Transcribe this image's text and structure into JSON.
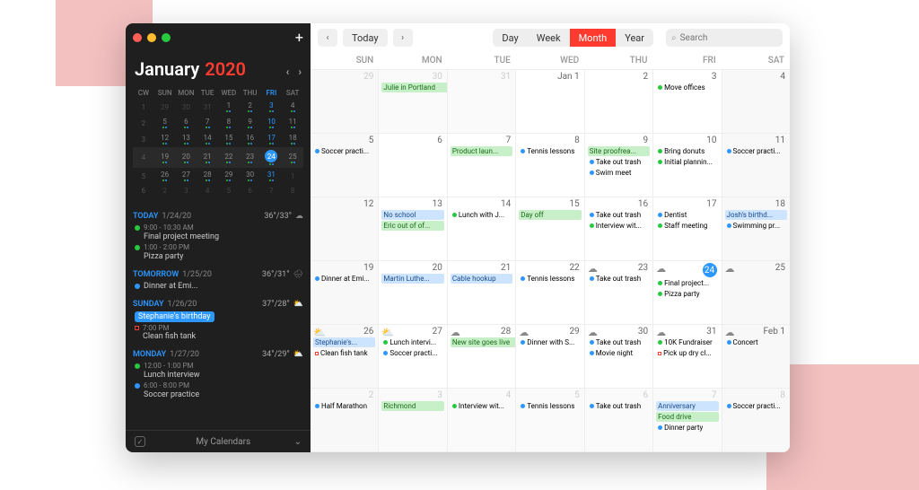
{
  "sidebar": {
    "month": "January",
    "year": "2020",
    "mini_headers": [
      "CW",
      "SUN",
      "MON",
      "TUE",
      "WED",
      "THU",
      "FRI",
      "SAT"
    ],
    "mini_rows": [
      {
        "cw": 1,
        "days": [
          29,
          30,
          31,
          1,
          2,
          3,
          4
        ],
        "dim": [
          0,
          1,
          2
        ]
      },
      {
        "cw": 2,
        "days": [
          5,
          6,
          7,
          8,
          9,
          10,
          11
        ]
      },
      {
        "cw": 3,
        "days": [
          12,
          13,
          14,
          15,
          16,
          17,
          18
        ]
      },
      {
        "cw": 4,
        "days": [
          19,
          20,
          21,
          22,
          23,
          24,
          25
        ],
        "sel": true,
        "today": 5
      },
      {
        "cw": 5,
        "days": [
          26,
          27,
          28,
          29,
          30,
          31,
          1
        ],
        "dim": [
          6
        ]
      },
      {
        "cw": 6,
        "days": [
          2,
          3,
          4,
          5,
          6,
          7,
          8
        ],
        "dim": [
          0,
          1,
          2,
          3,
          4,
          5,
          6
        ]
      }
    ],
    "agenda": [
      {
        "label": "TODAY",
        "date": "1/24/20",
        "temp": "36°/33°",
        "weather": "cloud",
        "events": [
          {
            "dot": "green",
            "time": "9:00 - 10:30 AM",
            "title": "Final project meeting"
          },
          {
            "dot": "green",
            "time": "1:00 - 2:00 PM",
            "title": "Pizza party"
          }
        ]
      },
      {
        "label": "TOMORROW",
        "date": "1/25/20",
        "temp": "36°/31°",
        "weather": "rain",
        "events": [
          {
            "dot": "blue",
            "title": "Dinner at Emi..."
          }
        ]
      },
      {
        "label": "SUNDAY",
        "date": "1/26/20",
        "temp": "37°/28°",
        "weather": "partly",
        "events": [
          {
            "pill": true,
            "title": "Stephanie's birthday"
          },
          {
            "sq": true,
            "time": "7:00 PM",
            "title": "Clean fish tank"
          }
        ]
      },
      {
        "label": "MONDAY",
        "date": "1/27/20",
        "temp": "34°/29°",
        "weather": "partly",
        "events": [
          {
            "dot": "green",
            "time": "12:00 - 1:00 PM",
            "title": "Lunch interview"
          },
          {
            "dot": "blue",
            "time": "6:00 - 8:00 PM",
            "title": "Soccer practice"
          }
        ]
      }
    ],
    "footer": "My Calendars"
  },
  "toolbar": {
    "today": "Today",
    "views": [
      "Day",
      "Week",
      "Month",
      "Year"
    ],
    "active": 2,
    "search_ph": "Search"
  },
  "wdays": [
    "SUN",
    "MON",
    "TUE",
    "WED",
    "THU",
    "FRI",
    "SAT"
  ],
  "weeks": [
    [
      {
        "num": "29",
        "oom": true,
        "we": true
      },
      {
        "num": "30",
        "oom": true,
        "ev": [
          {
            "type": "bar-g",
            "span": 4,
            "label": "Julie in Portland"
          }
        ]
      },
      {
        "num": "31",
        "oom": true
      },
      {
        "num": "Jan 1"
      },
      {
        "num": "2"
      },
      {
        "num": "3",
        "ev": [
          {
            "dot": "green",
            "label": "Move offices"
          }
        ]
      },
      {
        "num": "4",
        "we": true
      }
    ],
    [
      {
        "num": "5",
        "we": true,
        "ev": [
          {
            "dot": "blue",
            "label": "Soccer practi..."
          }
        ]
      },
      {
        "num": "6"
      },
      {
        "num": "7",
        "ev": [
          {
            "type": "bar-g",
            "label": "Product laun..."
          }
        ]
      },
      {
        "num": "8",
        "ev": [
          {
            "dot": "blue",
            "label": "Tennis lessons"
          }
        ]
      },
      {
        "num": "9",
        "ev": [
          {
            "type": "bar-g",
            "label": "Site proofrea..."
          },
          {
            "dot": "blue",
            "label": "Take out trash"
          },
          {
            "dot": "blue",
            "label": "Swim meet"
          }
        ]
      },
      {
        "num": "10",
        "ev": [
          {
            "dot": "green",
            "label": "Bring donuts"
          },
          {
            "dot": "green",
            "label": "Initial plannin..."
          }
        ]
      },
      {
        "num": "11",
        "we": true,
        "ev": [
          {
            "dot": "blue",
            "label": "Soccer practi..."
          }
        ]
      }
    ],
    [
      {
        "num": "12",
        "we": true
      },
      {
        "num": "13",
        "ev": [
          {
            "type": "bar-b",
            "label": "No school"
          },
          {
            "type": "bar-g",
            "label": "Eric out of of..."
          }
        ]
      },
      {
        "num": "14",
        "ev": [
          {
            "dot": "green",
            "label": "Lunch with J..."
          }
        ]
      },
      {
        "num": "15",
        "ev": [
          {
            "type": "bar-g",
            "label": "Day off"
          }
        ]
      },
      {
        "num": "16",
        "ev": [
          {
            "dot": "blue",
            "label": "Take out trash"
          },
          {
            "dot": "green",
            "label": "Interview wit..."
          }
        ]
      },
      {
        "num": "17",
        "ev": [
          {
            "dot": "blue",
            "label": "Dentist"
          },
          {
            "dot": "green",
            "label": "Staff meeting"
          }
        ]
      },
      {
        "num": "18",
        "we": true,
        "ev": [
          {
            "type": "bar-b",
            "label": "Josh's birthd..."
          },
          {
            "dot": "blue",
            "label": "Swimming pr..."
          }
        ]
      }
    ],
    [
      {
        "num": "19",
        "we": true,
        "ev": [
          {
            "dot": "blue",
            "label": "Dinner at Emi..."
          }
        ]
      },
      {
        "num": "20",
        "ev": [
          {
            "type": "bar-b",
            "label": "Martin Luthe..."
          }
        ]
      },
      {
        "num": "21",
        "ev": [
          {
            "type": "bar-b",
            "label": "Cable hookup"
          }
        ]
      },
      {
        "num": "22",
        "ev": [
          {
            "dot": "blue",
            "label": "Tennis lessons"
          }
        ]
      },
      {
        "num": "23",
        "w": "☁",
        "ev": [
          {
            "dot": "blue",
            "label": "Take out trash"
          }
        ]
      },
      {
        "num": "24",
        "today": true,
        "w": "☁",
        "ev": [
          {
            "dot": "green",
            "label": "Final project..."
          },
          {
            "dot": "green",
            "label": "Pizza party"
          }
        ]
      },
      {
        "num": "25",
        "we": true,
        "w": "☁"
      }
    ],
    [
      {
        "num": "26",
        "we": true,
        "w": "⛅",
        "ev": [
          {
            "type": "bar-b",
            "label": "Stephanie's..."
          },
          {
            "sq": true,
            "label": "Clean fish tank"
          }
        ]
      },
      {
        "num": "27",
        "w": "⛅",
        "ev": [
          {
            "dot": "green",
            "label": "Lunch intervi..."
          },
          {
            "dot": "blue",
            "label": "Soccer practi..."
          }
        ]
      },
      {
        "num": "28",
        "w": "☁",
        "ev": [
          {
            "type": "bar-g",
            "span": 3,
            "label": "New site goes live"
          }
        ]
      },
      {
        "num": "29",
        "w": "☁",
        "ev": [
          {
            "dot": "blue",
            "label": "Dinner with S..."
          }
        ]
      },
      {
        "num": "30",
        "w": "☁",
        "ev": [
          {
            "dot": "blue",
            "label": "Take out trash"
          },
          {
            "dot": "blue",
            "label": "Movie night"
          }
        ]
      },
      {
        "num": "31",
        "w": "☁",
        "ev": [
          {
            "dot": "green",
            "label": "10K Fundraiser"
          },
          {
            "sq": true,
            "label": "Pick up dry cl..."
          }
        ]
      },
      {
        "num": "Feb 1",
        "we": true,
        "w": "☁",
        "ev": [
          {
            "dot": "blue",
            "label": "Concert"
          }
        ]
      }
    ],
    [
      {
        "num": "2",
        "we": true,
        "oom": true,
        "ev": [
          {
            "dot": "blue",
            "label": "Half Marathon"
          }
        ]
      },
      {
        "num": "3",
        "oom": true,
        "ev": [
          {
            "type": "bar-g",
            "label": "Richmond"
          }
        ]
      },
      {
        "num": "4",
        "oom": true,
        "ev": [
          {
            "dot": "green",
            "label": "Interview wit..."
          }
        ]
      },
      {
        "num": "5",
        "oom": true,
        "ev": [
          {
            "dot": "blue",
            "label": "Tennis lessons"
          }
        ]
      },
      {
        "num": "6",
        "oom": true,
        "ev": [
          {
            "dot": "blue",
            "label": "Take out trash"
          }
        ]
      },
      {
        "num": "7",
        "oom": true,
        "ev": [
          {
            "type": "bar-b",
            "label": "Anniversary"
          },
          {
            "type": "bar-g",
            "label": "Food drive"
          },
          {
            "dot": "blue",
            "label": "Dinner party"
          }
        ]
      },
      {
        "num": "8",
        "we": true,
        "oom": true,
        "ev": [
          {
            "dot": "blue",
            "label": "Soccer practi..."
          }
        ]
      }
    ]
  ]
}
